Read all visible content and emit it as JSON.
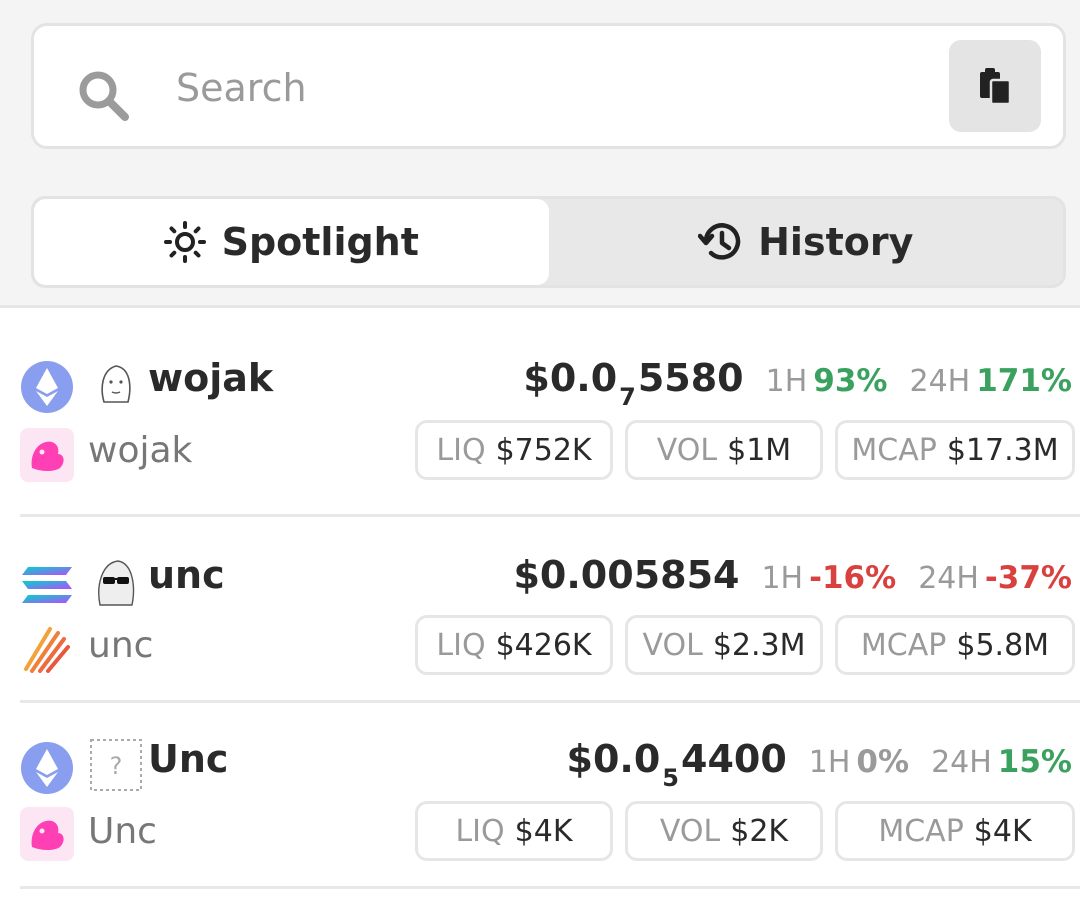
{
  "search": {
    "placeholder": "Search"
  },
  "tabs": [
    {
      "label": "Spotlight",
      "icon": "sun-icon",
      "active": true
    },
    {
      "label": "History",
      "icon": "history-icon",
      "active": false
    }
  ],
  "tokens": [
    {
      "symbol": "wojak",
      "name": "wojak",
      "chain": "ethereum-icon",
      "dex": "uniswap-icon",
      "price_prefix": "$0.0",
      "price_zeros": "7",
      "price_digits": "5580",
      "change_1h_label": "1H",
      "change_1h": "93%",
      "change_24h_label": "24H",
      "change_24h": "171%",
      "liq_label": "LIQ",
      "liq": "$752K",
      "vol_label": "VOL",
      "vol": "$1M",
      "mcap_label": "MCAP",
      "mcap": "$17.3M"
    },
    {
      "symbol": "unc",
      "name": "unc",
      "chain": "solana-icon",
      "dex": "meteora-icon",
      "price_prefix": "$0.005854",
      "price_zeros": "",
      "price_digits": "",
      "change_1h_label": "1H",
      "change_1h": "-16%",
      "change_24h_label": "24H",
      "change_24h": "-37%",
      "liq_label": "LIQ",
      "liq": "$426K",
      "vol_label": "VOL",
      "vol": "$2.3M",
      "mcap_label": "MCAP",
      "mcap": "$5.8M"
    },
    {
      "symbol": "Unc",
      "name": "Unc",
      "chain": "ethereum-icon",
      "dex": "uniswap-icon",
      "price_prefix": "$0.0",
      "price_zeros": "5",
      "price_digits": "4400",
      "change_1h_label": "1H",
      "change_1h": "0%",
      "change_24h_label": "24H",
      "change_24h": "15%",
      "liq_label": "LIQ",
      "liq": "$4K",
      "vol_label": "VOL",
      "vol": "$2K",
      "mcap_label": "MCAP",
      "mcap": "$4K"
    }
  ],
  "colors": {
    "positive": "#3aa15f",
    "negative": "#d9413f",
    "neutral": "#9a9a9a"
  }
}
